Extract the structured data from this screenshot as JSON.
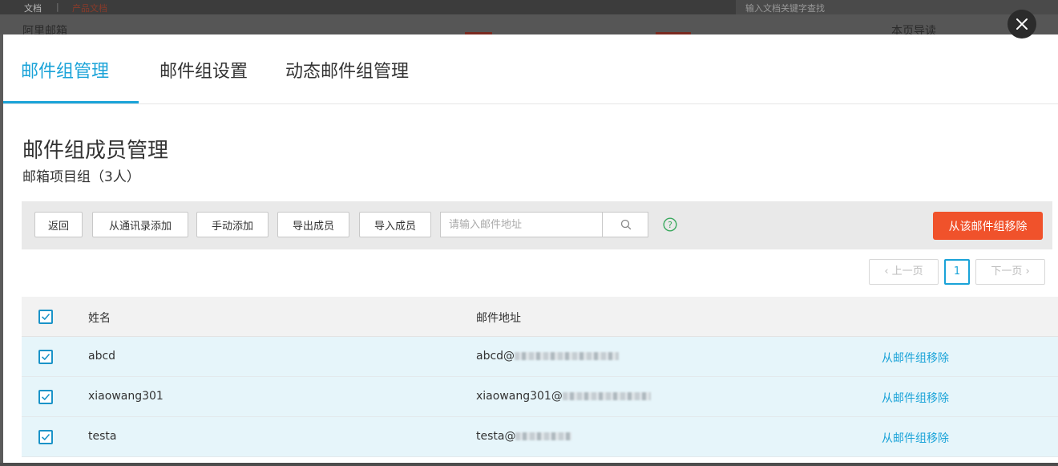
{
  "background": {
    "topbar_links": [
      "文档",
      "产品文档"
    ],
    "search_placeholder": "输入文档关键字查找",
    "strip_left": "阿里邮箱",
    "strip_right": "本页导读"
  },
  "close_icon": "close-icon",
  "tabs": [
    {
      "label": "邮件组管理",
      "active": true
    },
    {
      "label": "邮件组设置",
      "active": false
    },
    {
      "label": "动态邮件组管理",
      "active": false
    }
  ],
  "page_title": "邮件组成员管理",
  "subtitle": "邮箱项目组（3人）",
  "toolbar": {
    "back": "返回",
    "add_from_contacts": "从通讯录添加",
    "manual_add": "手动添加",
    "export": "导出成员",
    "import": "导入成员",
    "search_placeholder": "请输入邮件地址",
    "search_icon": "search-icon",
    "help_icon": "help-icon",
    "remove_from_group": "从该邮件组移除"
  },
  "pagination": {
    "prev": "‹ 上一页",
    "current": "1",
    "next": "下一页 ›"
  },
  "table": {
    "headers": {
      "name": "姓名",
      "email": "邮件地址"
    },
    "header_checked": true,
    "rows": [
      {
        "name": "abcd",
        "email_prefix": "abcd@",
        "action": "从邮件组移除",
        "checked": true
      },
      {
        "name": "xiaowang301",
        "email_prefix": "xiaowang301@",
        "action": "从邮件组移除",
        "checked": true
      },
      {
        "name": "testa",
        "email_prefix": "testa@",
        "action": "从邮件组移除",
        "checked": true
      }
    ]
  },
  "colors": {
    "accent": "#1aa3d8",
    "danger": "#f0522b",
    "row_highlight": "#e6f5fa",
    "help": "#3aa95e"
  }
}
